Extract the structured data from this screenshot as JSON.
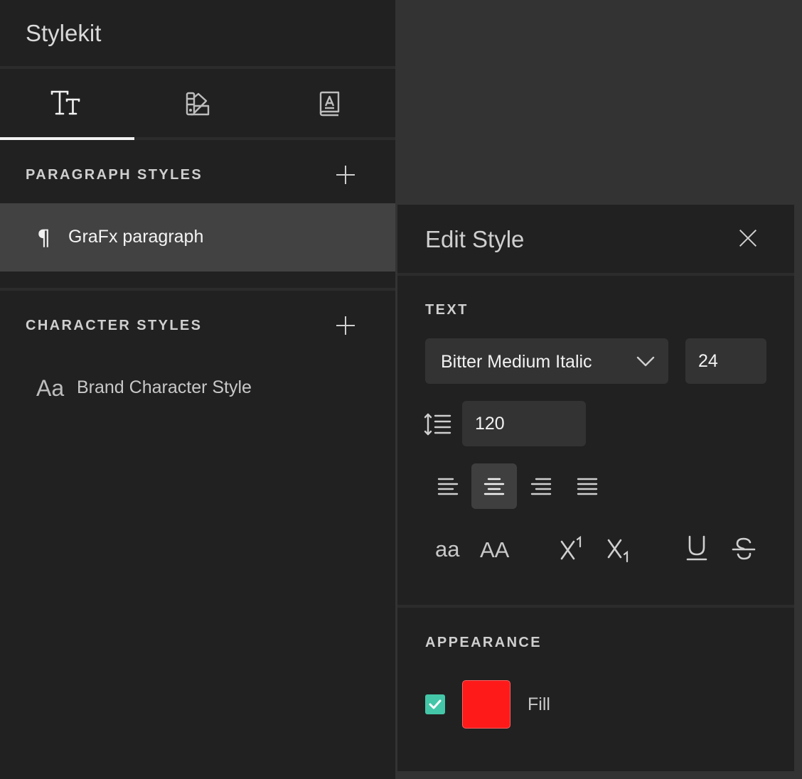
{
  "left_panel": {
    "title": "Stylekit",
    "tabs": [
      {
        "icon": "text-styles-icon",
        "active": true
      },
      {
        "icon": "color-swatches-icon",
        "active": false
      },
      {
        "icon": "brand-book-icon",
        "active": false
      }
    ],
    "paragraph_styles": {
      "heading": "PARAGRAPH STYLES",
      "items": [
        {
          "icon": "pilcrow-icon",
          "glyph": "¶",
          "label": "GraFx paragraph",
          "selected": true
        }
      ]
    },
    "character_styles": {
      "heading": "CHARACTER STYLES",
      "items": [
        {
          "icon": "character-style-icon",
          "glyph": "Aa",
          "label": "Brand Character Style"
        }
      ]
    }
  },
  "edit_style": {
    "title": "Edit Style",
    "text_section": {
      "heading": "TEXT",
      "font": "Bitter Medium Italic",
      "font_size": "24",
      "line_height": "120",
      "alignment_options": [
        "left",
        "center",
        "right",
        "justify"
      ],
      "alignment_selected": "center",
      "case_options": [
        "aa",
        "AA"
      ],
      "script_options": [
        "superscript",
        "subscript"
      ],
      "decoration_options": [
        "underline",
        "strikethrough"
      ]
    },
    "appearance_section": {
      "heading": "APPEARANCE",
      "fill_enabled": true,
      "fill_color": "#ff1a1a",
      "fill_label": "Fill"
    }
  },
  "colors": {
    "panel_bg": "#212121",
    "canvas_bg": "#333333",
    "selected_row": "#424242",
    "checkbox_accent": "#43c7a8"
  }
}
